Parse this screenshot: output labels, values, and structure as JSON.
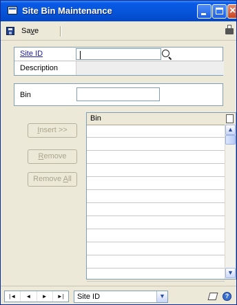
{
  "window": {
    "title": "Site Bin Maintenance",
    "minimize_glyph": "_",
    "close_glyph": "×"
  },
  "toolbar": {
    "save_label": "Save",
    "save_mnemonic_prefix": "Sa",
    "save_mnemonic": "v",
    "save_mnemonic_suffix": "e"
  },
  "header": {
    "site_id_label": "Site ID",
    "site_id_value": "",
    "description_label": "Description",
    "description_value": ""
  },
  "bin_entry": {
    "label": "Bin",
    "value": ""
  },
  "actions": {
    "insert_pre": "",
    "insert_mnemonic": "I",
    "insert_post": "nsert >>",
    "remove_pre": "",
    "remove_mnemonic": "R",
    "remove_post": "emove",
    "remove_all_pre": "Remove ",
    "remove_all_mnemonic": "A",
    "remove_all_post": "ll"
  },
  "grid": {
    "column_header": "Bin",
    "rows": [
      "",
      "",
      "",
      "",
      "",
      "",
      "",
      "",
      "",
      "",
      "",
      ""
    ],
    "scroll_up": "▲",
    "scroll_down": "▼"
  },
  "statusbar": {
    "first": "|◄",
    "prev": "◄",
    "next": "►",
    "last": "►|",
    "sort_by": "Site ID",
    "dropdown_glyph": "▼",
    "help_glyph": "?"
  },
  "colors": {
    "titlebar": "#0654d8",
    "link": "#1a1aa8",
    "disabled_text": "#a8a48c"
  }
}
